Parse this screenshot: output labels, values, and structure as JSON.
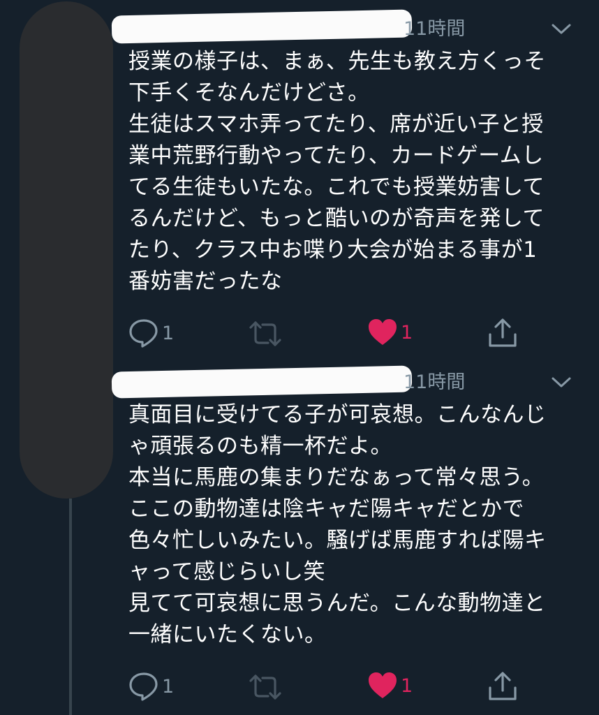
{
  "colors": {
    "background": "#15202b",
    "text": "#ffffff",
    "muted": "#8899a6",
    "like": "#e0245e"
  },
  "tweets": [
    {
      "time": "11時間",
      "text": "授業の様子は、まぁ、先生も教え方くっそ\n下手くそなんだけどさ。\n生徒はスマホ弄ってたり、席が近い子と授\n業中荒野行動やってたり、カードゲームし\nてる生徒もいたな。これでも授業妨害して\nるんだけど、もっと酷いのが奇声を発して\nたり、クラス中お喋り大会が始まる事が1\n番妨害だったな",
      "reply_count": "1",
      "like_count": "1",
      "icons": [
        "chevron-down-icon",
        "reply-icon",
        "retweet-icon",
        "heart-icon",
        "share-icon"
      ]
    },
    {
      "time": "11時間",
      "text": "真面目に受けてる子が可哀想。こんなんじ\nゃ頑張るのも精一杯だよ。\n本当に馬鹿の集まりだなぁって常々思う。\nここの動物達は陰キャだ陽キャだとかで\n色々忙しいみたい。騒げば馬鹿すれば陽キ\nャって感じらいし笑\n見てて可哀想に思うんだ。こんな動物達と\n一緒にいたくない。",
      "reply_count": "1",
      "like_count": "1",
      "icons": [
        "chevron-down-icon",
        "reply-icon",
        "retweet-icon",
        "heart-icon",
        "share-icon"
      ]
    }
  ]
}
